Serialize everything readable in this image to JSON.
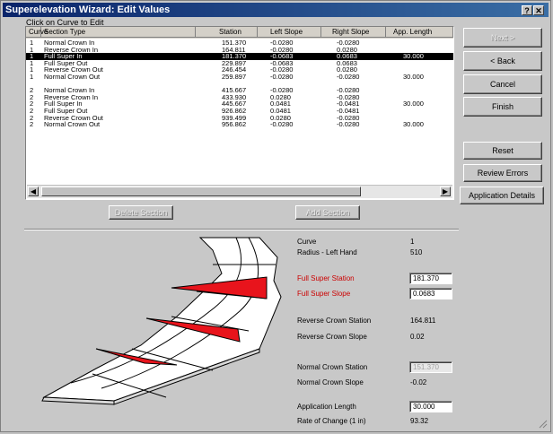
{
  "window": {
    "title": "Superelevation Wizard: Edit Values",
    "help_glyph": "?",
    "close_glyph": "✕"
  },
  "list": {
    "hint": "Click on Curve to Edit",
    "columns": [
      "Curve",
      "Section Type",
      "Station",
      "Left Slope",
      "Right Slope",
      "App. Length"
    ],
    "rows": [
      {
        "curve": "1",
        "type": "Normal Crown In",
        "station": "151.370",
        "left": "-0.0280",
        "right": "-0.0280",
        "app": "",
        "selected": false
      },
      {
        "curve": "1",
        "type": "Reverse Crown In",
        "station": "164.811",
        "left": "-0.0280",
        "right": "0.0280",
        "app": "",
        "selected": false
      },
      {
        "curve": "1",
        "type": "Full Super In",
        "station": "181.370",
        "left": "-0.0683",
        "right": "0.0683",
        "app": "30.000",
        "selected": true
      },
      {
        "curve": "1",
        "type": "Full Super Out",
        "station": "229.897",
        "left": "-0.0683",
        "right": "0.0683",
        "app": "",
        "selected": false
      },
      {
        "curve": "1",
        "type": "Reverse Crown Out",
        "station": "246.454",
        "left": "-0.0280",
        "right": "0.0280",
        "app": "",
        "selected": false
      },
      {
        "curve": "1",
        "type": "Normal Crown Out",
        "station": "259.897",
        "left": "-0.0280",
        "right": "-0.0280",
        "app": "30.000",
        "selected": false
      },
      {
        "curve": "",
        "type": "",
        "station": "",
        "left": "",
        "right": "",
        "app": "",
        "selected": false
      },
      {
        "curve": "2",
        "type": "Normal Crown In",
        "station": "415.667",
        "left": "-0.0280",
        "right": "-0.0280",
        "app": "",
        "selected": false
      },
      {
        "curve": "2",
        "type": "Reverse Crown In",
        "station": "433.930",
        "left": "0.0280",
        "right": "-0.0280",
        "app": "",
        "selected": false
      },
      {
        "curve": "2",
        "type": "Full Super In",
        "station": "445.667",
        "left": "0.0481",
        "right": "-0.0481",
        "app": "30.000",
        "selected": false
      },
      {
        "curve": "2",
        "type": "Full Super Out",
        "station": "926.862",
        "left": "0.0481",
        "right": "-0.0481",
        "app": "",
        "selected": false
      },
      {
        "curve": "2",
        "type": "Reverse Crown Out",
        "station": "939.499",
        "left": "0.0280",
        "right": "-0.0280",
        "app": "",
        "selected": false
      },
      {
        "curve": "2",
        "type": "Normal Crown Out",
        "station": "956.862",
        "left": "-0.0280",
        "right": "-0.0280",
        "app": "30.000",
        "selected": false
      }
    ]
  },
  "mid_buttons": {
    "delete_section": "Delete Section",
    "add_section": "Add Section"
  },
  "side_buttons": {
    "next": "Next >",
    "back": "< Back",
    "cancel": "Cancel",
    "finish": "Finish",
    "reset": "Reset",
    "review_errors": "Review Errors",
    "application_details": "Application Details"
  },
  "details": {
    "curve_label": "Curve",
    "curve_value": "1",
    "radius_label": "Radius - Left Hand",
    "radius_value": "510",
    "fs_station_label": "Full Super Station",
    "fs_station_value": "181.370",
    "fs_slope_label": "Full Super Slope",
    "fs_slope_value": "0.0683",
    "rc_station_label": "Reverse Crown Station",
    "rc_station_value": "164.811",
    "rc_slope_label": "Reverse Crown Slope",
    "rc_slope_value": "0.02",
    "nc_station_label": "Normal Crown Station",
    "nc_station_value": "151.370",
    "nc_slope_label": "Normal Crown Slope",
    "nc_slope_value": "-0.02",
    "app_length_label": "Application Length",
    "app_length_value": "30.000",
    "rate_label": "Rate of Change (1 in)",
    "rate_value": "93.32"
  },
  "colors": {
    "title_start": "#0a246a",
    "title_end": "#3a6ea5",
    "highlight_red": "#cc0000",
    "wedge_red": "#e8141c"
  }
}
